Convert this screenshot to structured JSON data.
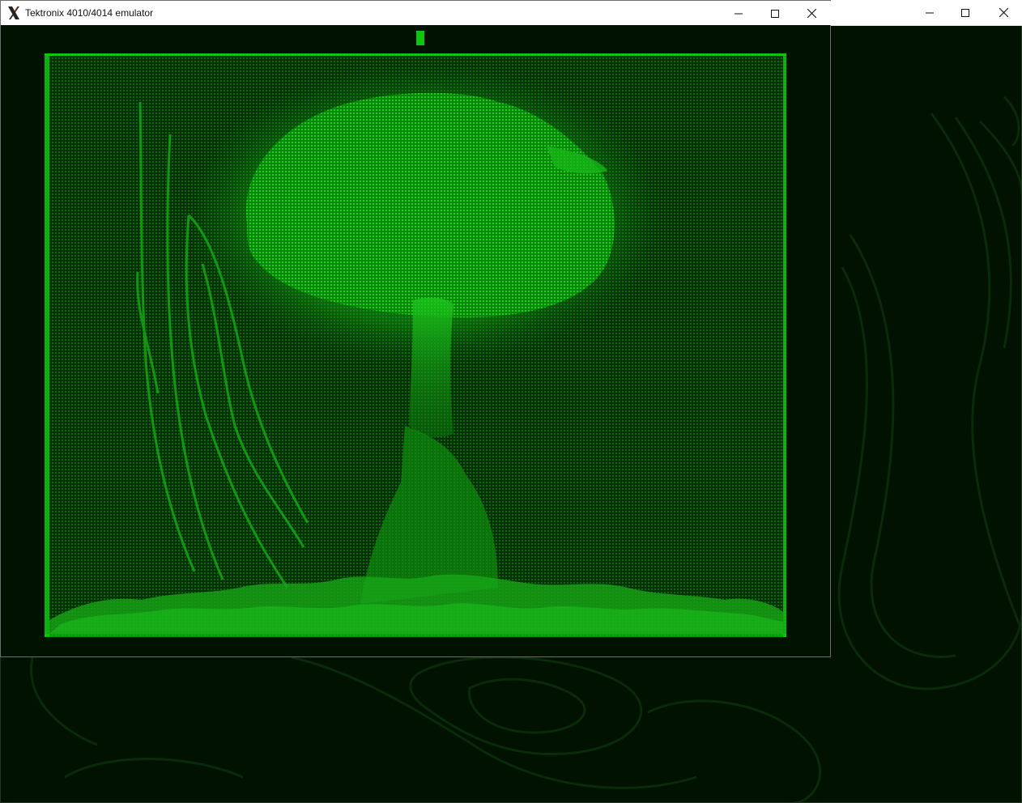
{
  "window": {
    "title": "Tektronix 4010/4014 emulator",
    "icon": "x-logo-icon"
  },
  "controls": {
    "minimize": "minimize-icon",
    "maximize": "maximize-icon",
    "close": "close-icon"
  },
  "colors": {
    "desktop": "#011201",
    "phosphor": "#12c412",
    "titlebar": "#ffffff"
  },
  "screen": {
    "content": "mushroom-cloud-image",
    "cursor": "cursor-block"
  }
}
